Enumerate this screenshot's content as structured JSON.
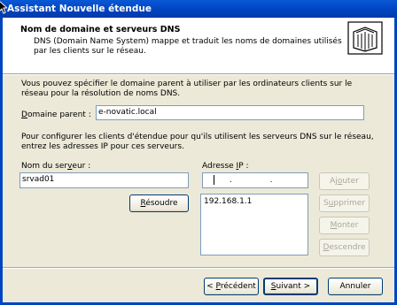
{
  "window": {
    "title": "Assistant Nouvelle étendue"
  },
  "header": {
    "title": "Nom de domaine et serveurs DNS",
    "description": "DNS (Domain Name System) mappe et traduit les noms de domaines utilisés par les clients sur le réseau.",
    "icon": "folder-wizard-icon"
  },
  "domain_section": {
    "intro": "Vous pouvez spécifier le domaine parent à utiliser par les ordinateurs clients sur le réseau pour la résolution de noms DNS.",
    "parent_label": "Domaine parent :",
    "parent_value": "e-novatic.local"
  },
  "dns_section": {
    "intro": "Pour configurer les clients d'étendue pour qu'ils utilisent les serveurs DNS sur le réseau, entrez les adresses IP pour ces serveurs.",
    "server_name_label": "Nom du serveur :",
    "server_name_value": "srvad01",
    "ip_label": "Adresse IP :",
    "ip_value": ". . .",
    "resolve_button": "Résoudre",
    "ip_list": [
      "192.168.1.1"
    ],
    "add_button": "Ajouter",
    "remove_button": "Supprimer",
    "up_button": "Monter",
    "down_button": "Descendre"
  },
  "footer": {
    "back_button": "< Précédent",
    "next_button": "Suivant >",
    "cancel_button": "Annuler"
  }
}
